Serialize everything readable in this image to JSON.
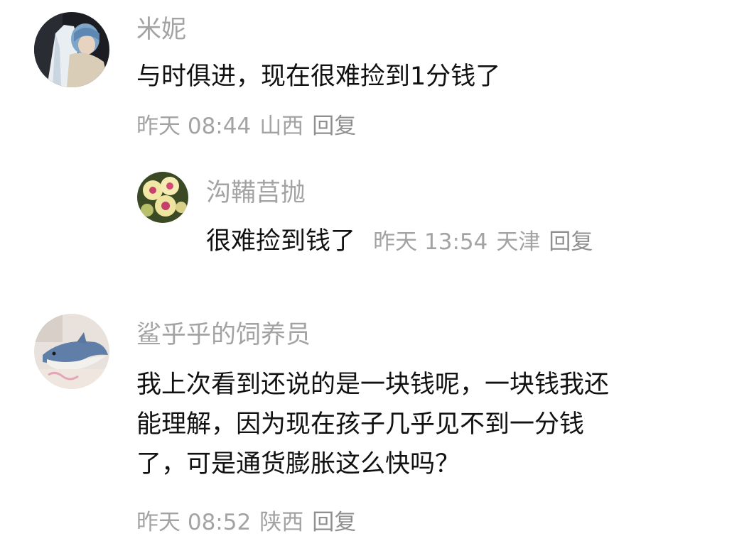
{
  "comments": [
    {
      "username": "米妮",
      "lines": [
        "与时俱进，现在很难捡到1分钱了"
      ],
      "time": "昨天 08:44",
      "location": "山西",
      "reply_label": "回复",
      "avatar_icon": "avatar-blue-hair-person",
      "replies": [
        {
          "username": "沟鞴莒抛",
          "content": "很难捡到钱了",
          "time": "昨天 13:54",
          "location": "天津",
          "reply_label": "回复",
          "avatar_icon": "avatar-orchid-flowers"
        }
      ]
    },
    {
      "username": "鲨乎乎的饲养员",
      "lines": [
        "我上次看到还说的是一块钱呢，一块钱我还",
        "能理解，因为现在孩子几乎见不到一分钱",
        "了，可是通货膨胀这么快吗？"
      ],
      "time": "昨天 08:52",
      "location": "陕西",
      "reply_label": "回复",
      "avatar_icon": "avatar-shark-plush"
    }
  ],
  "colors": {
    "username": "#a3a3a3",
    "content": "#111111",
    "meta": "#a3a3a3"
  }
}
